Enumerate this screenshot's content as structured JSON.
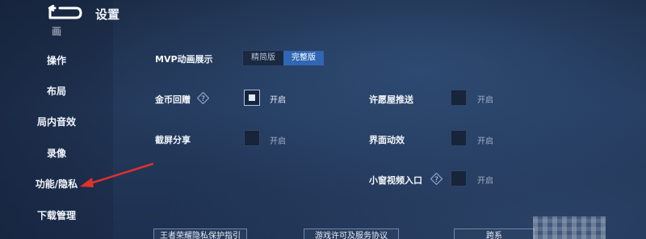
{
  "header": {
    "title": "设置"
  },
  "sidebar": {
    "items": [
      {
        "label": "画",
        "partial": true
      },
      {
        "label": "操作"
      },
      {
        "label": "布局"
      },
      {
        "label": "局内音效"
      },
      {
        "label": "录像"
      },
      {
        "label": "功能/隐私"
      },
      {
        "label": "下载管理"
      }
    ]
  },
  "settings": {
    "mvp": {
      "label": "MVP动画展示",
      "options": [
        "精简版",
        "完整版"
      ],
      "selected": "完整版"
    },
    "coin_replay": {
      "label": "金币回赠",
      "checked": true,
      "state_text": "开启"
    },
    "screenshot_share": {
      "label": "截屏分享",
      "checked": false,
      "state_text": "开启"
    },
    "wish_push": {
      "label": "许愿屋推送",
      "checked": false,
      "state_text": "开启"
    },
    "ui_effects": {
      "label": "界面动效",
      "checked": false,
      "state_text": "开启"
    },
    "mini_window": {
      "label": "小窗视频入口",
      "checked": false,
      "state_text": "开启"
    }
  },
  "footer": {
    "links": [
      "王者荣耀隐私保护指引",
      "游戏许可及服务协议",
      "跨系"
    ]
  },
  "colors": {
    "accent": "#2f67b3",
    "arrow": "#e0312b"
  }
}
